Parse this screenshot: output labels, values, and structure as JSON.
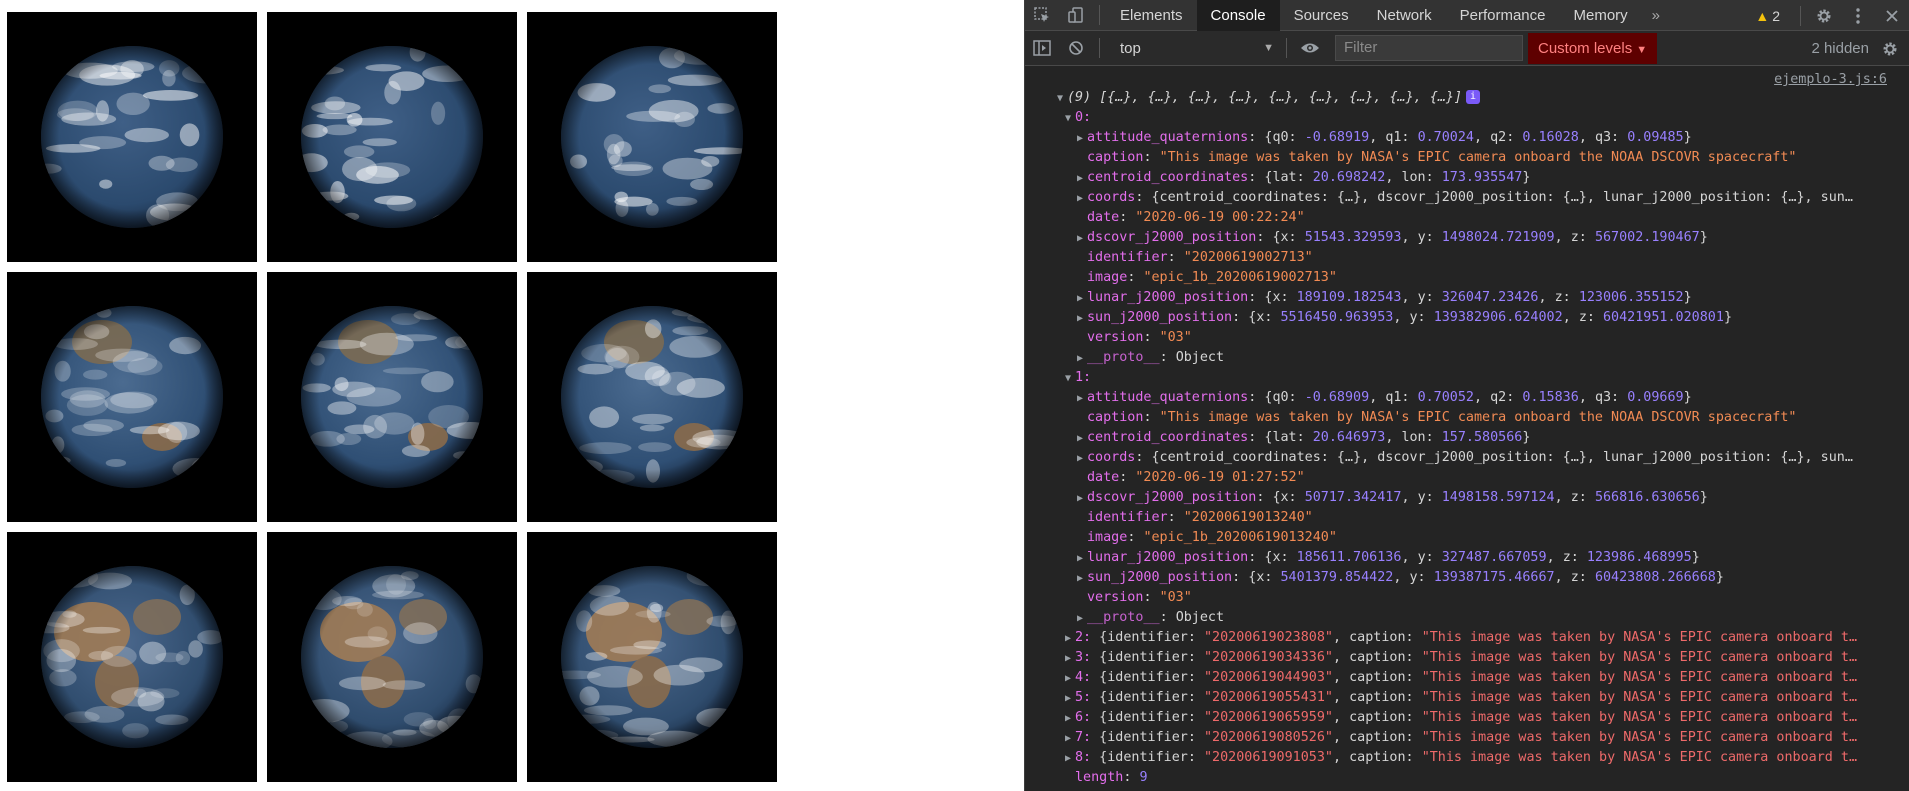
{
  "earth_images": [
    {
      "variant": "pacific-1"
    },
    {
      "variant": "pacific-2"
    },
    {
      "variant": "pacific-3"
    },
    {
      "variant": "asia-1"
    },
    {
      "variant": "asia-2"
    },
    {
      "variant": "asia-3"
    },
    {
      "variant": "africa-1"
    },
    {
      "variant": "africa-2"
    },
    {
      "variant": "africa-3"
    }
  ],
  "devtools": {
    "tabs": [
      "Elements",
      "Console",
      "Sources",
      "Network",
      "Performance",
      "Memory"
    ],
    "active_tab": "Console",
    "more_tabs": "»",
    "warnings_count": "2",
    "context": "top",
    "filter_placeholder": "Filter",
    "levels_label": "Custom levels",
    "hidden_count": "2 hidden",
    "source_link": "ejemplo-3.js:6",
    "array_summary": "(9) [{…}, {…}, {…}, {…}, {…}, {…}, {…}, {…}, {…}]",
    "info_badge": "i",
    "items": [
      {
        "index": "0:",
        "attitude_quaternions": {
          "q0": "-0.68919",
          "q1": "0.70024",
          "q2": "0.16028",
          "q3": "0.09485"
        },
        "caption": "\"This image was taken by NASA's EPIC camera onboard the NOAA DSCOVR spacecraft\"",
        "centroid_coordinates": {
          "lat": "20.698242",
          "lon": "173.935547"
        },
        "coords": "{centroid_coordinates: {…}, dscovr_j2000_position: {…}, lunar_j2000_position: {…}, sun…",
        "date": "\"2020-06-19 00:22:24\"",
        "dscovr_j2000_position": {
          "x": "51543.329593",
          "y": "1498024.721909",
          "z": "567002.190467"
        },
        "identifier": "\"20200619002713\"",
        "image": "\"epic_1b_20200619002713\"",
        "lunar_j2000_position": {
          "x": "189109.182543",
          "y": "326047.23426",
          "z": "123006.355152"
        },
        "sun_j2000_position": {
          "x": "5516450.963953",
          "y": "139382906.624002",
          "z": "60421951.020801"
        },
        "version": "\"03\"",
        "proto": "Object"
      },
      {
        "index": "1:",
        "attitude_quaternions": {
          "q0": "-0.68909",
          "q1": "0.70052",
          "q2": "0.15836",
          "q3": "0.09669"
        },
        "caption": "\"This image was taken by NASA's EPIC camera onboard the NOAA DSCOVR spacecraft\"",
        "centroid_coordinates": {
          "lat": "20.646973",
          "lon": "157.580566"
        },
        "coords": "{centroid_coordinates: {…}, dscovr_j2000_position: {…}, lunar_j2000_position: {…}, sun…",
        "date": "\"2020-06-19 01:27:52\"",
        "dscovr_j2000_position": {
          "x": "50717.342417",
          "y": "1498158.597124",
          "z": "566816.630656"
        },
        "identifier": "\"20200619013240\"",
        "image": "\"epic_1b_20200619013240\"",
        "lunar_j2000_position": {
          "x": "185611.706136",
          "y": "327487.667059",
          "z": "123986.468995"
        },
        "sun_j2000_position": {
          "x": "5401379.854422",
          "y": "139387175.46667",
          "z": "60423808.266668"
        },
        "version": "\"03\"",
        "proto": "Object"
      }
    ],
    "collapsed_items": [
      {
        "index": "2:",
        "identifier": "\"20200619023808\""
      },
      {
        "index": "3:",
        "identifier": "\"20200619034336\""
      },
      {
        "index": "4:",
        "identifier": "\"20200619044903\""
      },
      {
        "index": "5:",
        "identifier": "\"20200619055431\""
      },
      {
        "index": "6:",
        "identifier": "\"20200619065959\""
      },
      {
        "index": "7:",
        "identifier": "\"20200619080526\""
      },
      {
        "index": "8:",
        "identifier": "\"20200619091053\""
      }
    ],
    "collapsed_caption": "\"This image was taken by NASA's EPIC camera onboard t…",
    "length_key": "length",
    "length_value": "9",
    "colors": {
      "key": "#e36eec",
      "number": "#9980ff",
      "string": "#f28b54",
      "active_tab_bg": "#1e1e1e",
      "levels_bg": "#5e0000"
    }
  }
}
